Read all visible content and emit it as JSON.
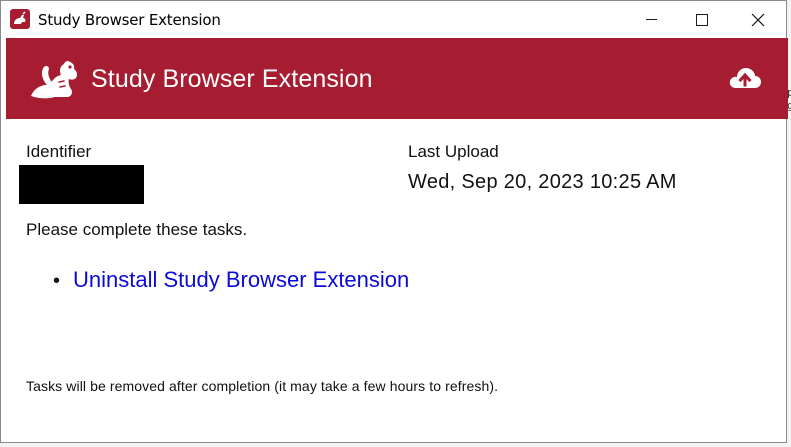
{
  "window": {
    "title": "Study Browser Extension",
    "controls": {
      "minimize": "minimize",
      "maximize": "maximize",
      "close": "✕"
    }
  },
  "header": {
    "title": "Study Browser Extension",
    "logo_icon": "chipmunk-icon",
    "upload_icon": "cloud-upload-icon",
    "color": "#a61c31"
  },
  "identifier": {
    "label": "Identifier"
  },
  "last_upload": {
    "label": "Last Upload",
    "value": "Wed, Sep 20, 2023 10:25 AM"
  },
  "tasks": {
    "intro": "Please complete these tasks.",
    "items": [
      {
        "bullet": "•",
        "label": "Uninstall Study Browser Extension"
      }
    ],
    "link_color": "#0b0bd6"
  },
  "footer": {
    "note": "Tasks will be removed after completion (it may take a few hours to refresh)."
  }
}
